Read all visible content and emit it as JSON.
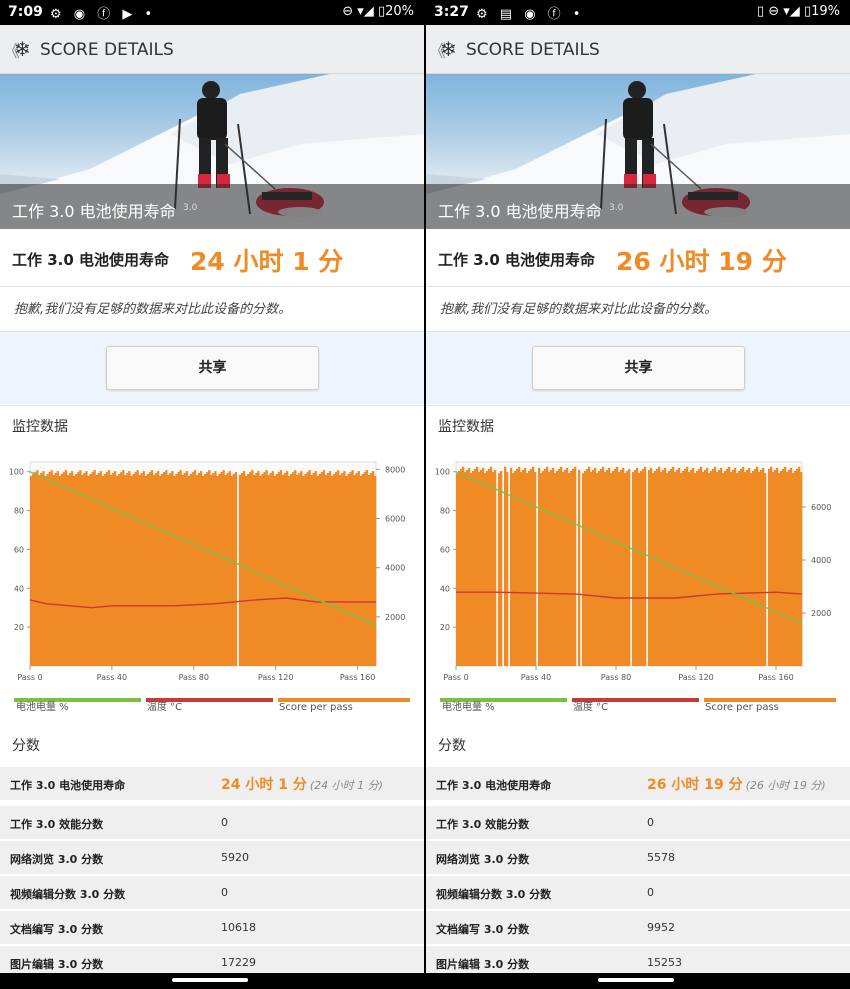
{
  "panels": [
    {
      "status": {
        "time": "7:09",
        "left_icons": "⚙ ◉ ⓕ ▶ •",
        "right_icons": "⊖ ▾◢",
        "battery": "▯20%"
      },
      "app_title": "SCORE DETAILS",
      "hero_text": "工作 3.0 电池使用寿命",
      "hero_version": "3.0",
      "result_label": "工作 3.0 电池使用寿命",
      "result_value": "24 小时 1 分",
      "note": "抱歉,我们没有足够的数据来对比此设备的分数。",
      "share_label": "共享",
      "monitor_title": "监控数据",
      "legend": [
        "电池电量 %",
        "温度 °C",
        "Score per pass"
      ],
      "score_title": "分数",
      "scores": [
        {
          "label": "工作 3.0 电池使用寿命",
          "value": "24 小时 1 分",
          "sub": "(24 小时 1 分)"
        },
        {
          "label": "工作 3.0 效能分数",
          "value": "0"
        },
        {
          "label": "网络浏览 3.0 分数",
          "value": "5920"
        },
        {
          "label": "视频编辑分数 3.0 分数",
          "value": "0"
        },
        {
          "label": "文档编写 3.0 分数",
          "value": "10618"
        },
        {
          "label": "图片编辑 3.0 分数",
          "value": "17229"
        }
      ],
      "chart_data": {
        "type": "bar",
        "x_ticks": [
          "Pass 0",
          "Pass 40",
          "Pass 80",
          "Pass 120",
          "Pass 160"
        ],
        "x_tick_values": [
          0,
          40,
          80,
          120,
          160
        ],
        "x_max": 169,
        "y_left_ticks": [
          20,
          40,
          60,
          80,
          100
        ],
        "y_left_range": [
          0,
          105
        ],
        "y_right_ticks": [
          "2000",
          "4000",
          "6000",
          "8000"
        ],
        "y_right_tick_values": [
          2000,
          4000,
          6000,
          8000
        ],
        "y_right_range": [
          0,
          8300
        ],
        "score_level": 7850,
        "gap_passes": [
          101
        ],
        "battery_line": {
          "start": 100,
          "end": 21
        },
        "temperature": [
          [
            0,
            34
          ],
          [
            8,
            32
          ],
          [
            20,
            31
          ],
          [
            30,
            30
          ],
          [
            40,
            31
          ],
          [
            50,
            31
          ],
          [
            70,
            31
          ],
          [
            90,
            32
          ],
          [
            110,
            34
          ],
          [
            125,
            35
          ],
          [
            140,
            33
          ],
          [
            169,
            33
          ]
        ],
        "colors": {
          "battery": "#7ac143",
          "temperature": "#c93a36",
          "score": "#f08a24"
        }
      }
    },
    {
      "status": {
        "time": "3:27",
        "left_icons": "⚙ ▤ ◉ ⓕ •",
        "right_icons": "▯ ⊖ ▾◢",
        "battery": "▯19%"
      },
      "app_title": "SCORE DETAILS",
      "hero_text": "工作 3.0 电池使用寿命",
      "hero_version": "3.0",
      "result_label": "工作 3.0 电池使用寿命",
      "result_value": "26 小时 19 分",
      "note": "抱歉,我们没有足够的数据来对比此设备的分数。",
      "share_label": "共享",
      "monitor_title": "监控数据",
      "legend": [
        "电池电量 %",
        "温度 °C",
        "Score per pass"
      ],
      "score_title": "分数",
      "scores": [
        {
          "label": "工作 3.0 电池使用寿命",
          "value": "26 小时 19 分",
          "sub": "(26 小时 19 分)"
        },
        {
          "label": "工作 3.0 效能分数",
          "value": "0"
        },
        {
          "label": "网络浏览 3.0 分数",
          "value": "5578"
        },
        {
          "label": "视频编辑分数 3.0 分数",
          "value": "0"
        },
        {
          "label": "文档编写 3.0 分数",
          "value": "9952"
        },
        {
          "label": "图片编辑 3.0 分数",
          "value": "15253"
        }
      ],
      "chart_data": {
        "type": "bar",
        "x_ticks": [
          "Pass 0",
          "Pass 40",
          "Pass 80",
          "Pass 120",
          "Pass 160"
        ],
        "x_tick_values": [
          0,
          40,
          80,
          120,
          160
        ],
        "x_max": 173,
        "y_left_ticks": [
          20,
          40,
          60,
          80,
          100
        ],
        "y_left_range": [
          0,
          105
        ],
        "y_right_ticks": [
          "2000",
          "4000",
          "6000"
        ],
        "y_right_tick_values": [
          2000,
          4000,
          6000
        ],
        "y_right_range": [
          0,
          7700
        ],
        "score_level": 7400,
        "gap_passes": [
          20,
          23,
          26,
          40,
          60,
          62,
          87,
          95,
          155
        ],
        "battery_line": {
          "start": 100,
          "end": 22
        },
        "temperature": [
          [
            0,
            38
          ],
          [
            20,
            38
          ],
          [
            60,
            37
          ],
          [
            80,
            35
          ],
          [
            110,
            35
          ],
          [
            130,
            37
          ],
          [
            160,
            38
          ],
          [
            173,
            37
          ]
        ],
        "colors": {
          "battery": "#7ac143",
          "temperature": "#c93a36",
          "score": "#f08a24"
        }
      }
    }
  ]
}
